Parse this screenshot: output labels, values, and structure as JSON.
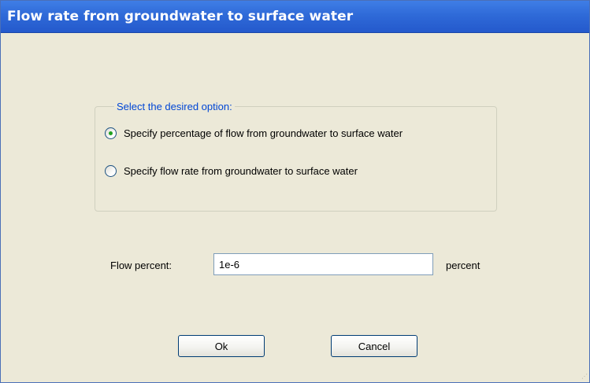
{
  "window": {
    "title": "Flow rate from groundwater to surface water"
  },
  "options_group": {
    "legend": "Select the desired option:",
    "options": [
      {
        "label": "Specify percentage of flow from groundwater to surface water",
        "selected": true
      },
      {
        "label": "Specify flow rate from groundwater to surface water",
        "selected": false
      }
    ]
  },
  "flow_field": {
    "label": "Flow percent:",
    "value": "1e-6",
    "unit": "percent"
  },
  "buttons": {
    "ok": "Ok",
    "cancel": "Cancel"
  },
  "colors": {
    "titlebar": "#2f6ad8",
    "window_bg": "#ece9d8",
    "legend_text": "#0046d5",
    "radio_selected_dot": "#21a121"
  }
}
